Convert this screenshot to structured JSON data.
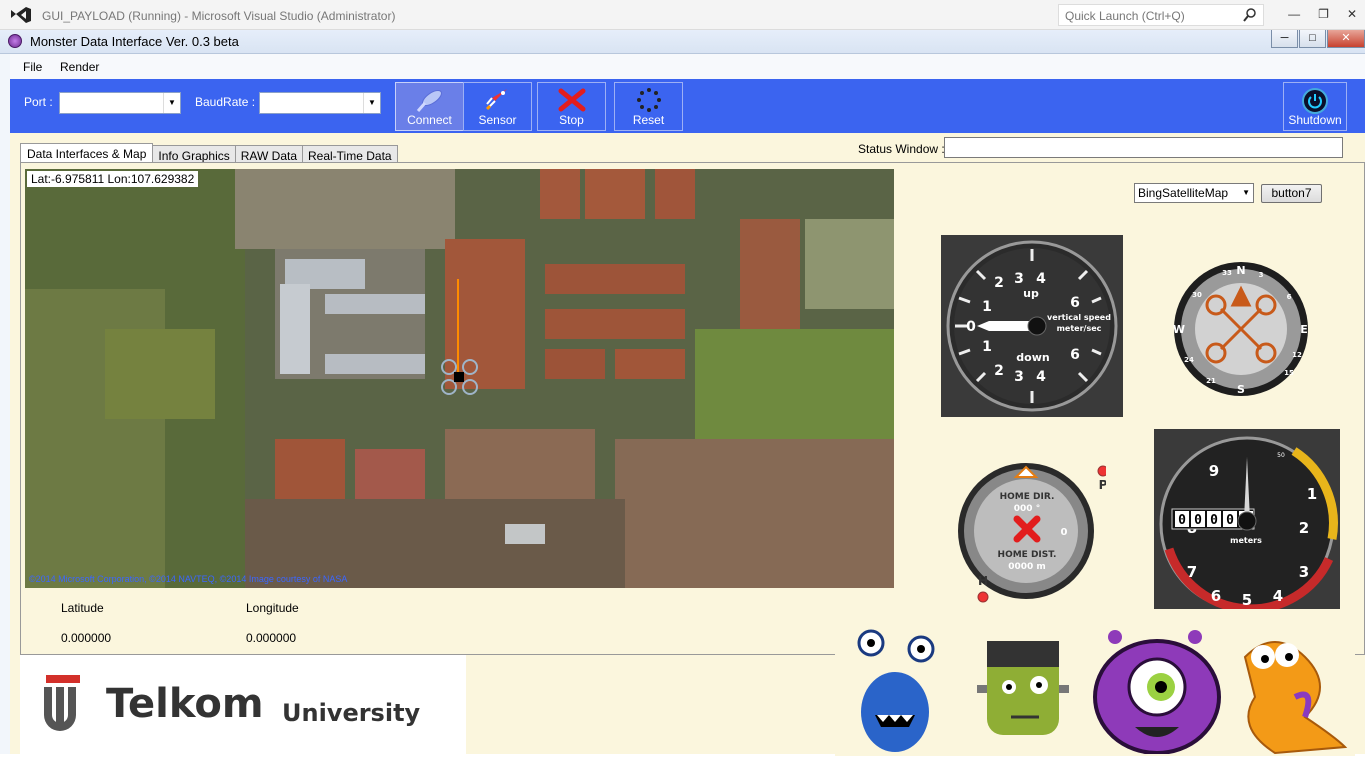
{
  "vs": {
    "title": "GUI_PAYLOAD (Running) - Microsoft Visual Studio (Administrator)",
    "quick_launch": "Quick Launch (Ctrl+Q)",
    "minimize": "—",
    "restore": "❐",
    "close": "✕"
  },
  "app": {
    "title": "Monster Data Interface Ver. 0.3 beta",
    "minimize": "─",
    "restore": "□",
    "close": "✕"
  },
  "menu": [
    "File",
    "Render"
  ],
  "toolbar": {
    "port_label": "Port :",
    "port_value": "",
    "baud_label": "BaudRate :",
    "baud_value": "",
    "buttons": [
      {
        "label": "Connect",
        "icon": "connect-icon"
      },
      {
        "label": "Sensor",
        "icon": "rocket-icon"
      },
      {
        "label": "Stop",
        "icon": "stop-icon"
      },
      {
        "label": "Reset",
        "icon": "reset-icon"
      }
    ],
    "shutdown_label": "Shutdown",
    "accent": "#3b64f0"
  },
  "tabs": [
    "Data Interfaces & Map",
    "Info Graphics",
    "RAW Data",
    "Real-Time Data"
  ],
  "status": {
    "label": "Status Window :",
    "value": ""
  },
  "map": {
    "latlon": "Lat:-6.975811 Lon:107.629382",
    "credit": "©2014 Microsoft Corporation, ©2014 NAVTEQ, ©2014 Image courtesy of NASA",
    "provider": "BingSatelliteMap",
    "button": "button7"
  },
  "coords": {
    "lat_label": "Latitude",
    "lon_label": "Longitude",
    "lat_value": "0.000000",
    "lon_value": "0.000000"
  },
  "vsi": {
    "up": "up",
    "down": "down",
    "caption1": "vertical speed",
    "caption2": "meter/sec",
    "left_ticks": [
      "1",
      "2",
      "1",
      "2"
    ],
    "ticks": [
      "3",
      "4",
      "6",
      "3",
      "4",
      "6",
      "2",
      "2"
    ],
    "zero": "0"
  },
  "heading": {
    "n": "N",
    "e": "E",
    "s": "S",
    "w": "W",
    "n_left": "33",
    "n_right": "3",
    "left_top": "30",
    "right_top": "6",
    "left_bottom": "24",
    "right_bottom": "15",
    "left_mid": "21",
    "right_mid": "12"
  },
  "home": {
    "dir_label": "HOME DIR.",
    "dir_value": "000 °",
    "dist_label": "HOME DIST.",
    "dist_value": "0000 m",
    "zero": "0",
    "p": "P",
    "h": "H"
  },
  "altimeter": {
    "counter": [
      "0",
      "0",
      "0",
      "0",
      "0"
    ],
    "unit": "meters",
    "ticks": [
      "9",
      "1",
      "2",
      "3",
      "4",
      "5",
      "6",
      "7",
      "8"
    ],
    "small": "50"
  },
  "logo": {
    "brand": "Telkom",
    "sub": "University"
  }
}
